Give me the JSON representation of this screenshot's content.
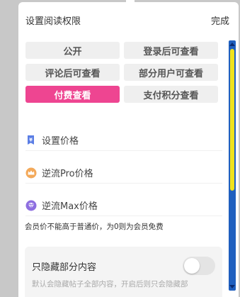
{
  "header": {
    "title": "设置阅读权限",
    "done_label": "完成"
  },
  "options": [
    {
      "label": "公开",
      "active": false
    },
    {
      "label": "登录后可查看",
      "active": false
    },
    {
      "label": "评论后可查看",
      "active": false
    },
    {
      "label": "部分用户可查看",
      "active": false
    },
    {
      "label": "付费查看",
      "active": true
    },
    {
      "label": "支付积分查看",
      "active": false
    }
  ],
  "price_rows": [
    {
      "label": "设置价格",
      "icon": "price-tag-icon"
    },
    {
      "label": "逆流Pro价格",
      "icon": "crown-icon"
    },
    {
      "label": "逆流Max价格",
      "icon": "diamond-icon"
    }
  ],
  "note": "会员价不能高于普通价，为0则为会员免费",
  "hide_section": {
    "title": "只隐藏部分内容",
    "toggle_on": false,
    "description": "默认会隐藏帖子全部内容，开启后则只会隐藏部"
  },
  "colors": {
    "accent": "#ee4591",
    "scrollbar": "#1f5fbf",
    "scroll_thumb": "#f0e21c"
  }
}
